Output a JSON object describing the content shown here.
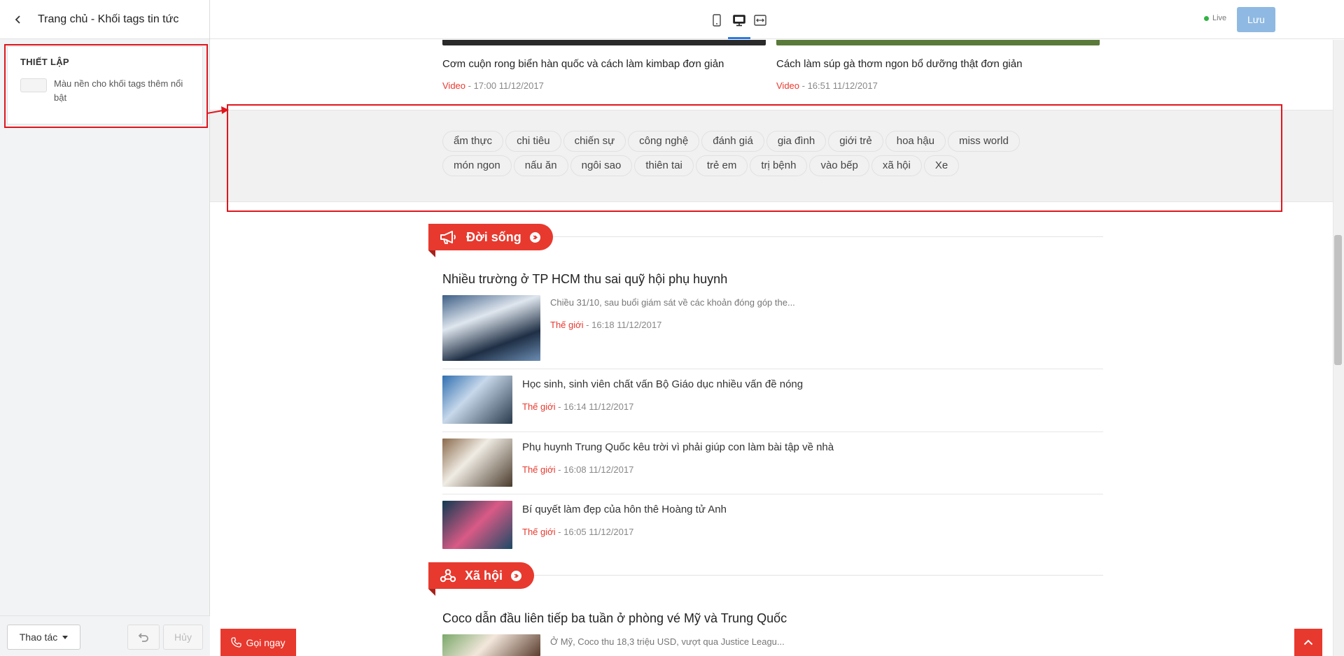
{
  "editor": {
    "title": "Trang chủ - Khối tags tin tức",
    "settings_title": "THIẾT LẬP",
    "bg_option_label": "Màu nền cho khối tags thêm nổi bật",
    "action_label": "Thao tác",
    "cancel_label": "Hủy",
    "live_label": "Live",
    "save_label": "Lưu"
  },
  "top_news": [
    {
      "title": "Cơm cuộn rong biển hàn quốc và cách làm kimbap đơn giản",
      "category": "Video",
      "time": "17:00 11/12/2017"
    },
    {
      "title": "Cách làm súp gà thơm ngon bổ dưỡng thật đơn giản",
      "category": "Video",
      "time": "16:51 11/12/2017"
    }
  ],
  "tags": [
    "ẩm thực",
    "chi tiêu",
    "chiến sự",
    "công nghệ",
    "đánh giá",
    "gia đình",
    "giới trẻ",
    "hoa hậu",
    "miss world",
    "món ngon",
    "nấu ăn",
    "ngôi sao",
    "thiên tai",
    "trẻ em",
    "trị bệnh",
    "vào bếp",
    "xã hội",
    "Xe"
  ],
  "sections": [
    {
      "name": "Đời sống",
      "lead": {
        "title": "Nhiều trường ở TP HCM thu sai quỹ hội phụ huynh",
        "desc": "Chiều 31/10, sau buổi giám sát về các khoản đóng góp the...",
        "category": "Thế giới",
        "time": "16:18 11/12/2017"
      },
      "items": [
        {
          "title": "Học sinh, sinh viên chất vấn Bộ Giáo dục nhiều vấn đề nóng",
          "category": "Thế giới",
          "time": "16:14 11/12/2017"
        },
        {
          "title": "Phụ huynh Trung Quốc kêu trời vì phải giúp con làm bài tập về nhà",
          "category": "Thế giới",
          "time": "16:08 11/12/2017"
        },
        {
          "title": "Bí quyết làm đẹp của hôn thê Hoàng tử Anh",
          "category": "Thế giới",
          "time": "16:05 11/12/2017"
        }
      ]
    },
    {
      "name": "Xã hội",
      "lead": {
        "title": "Coco dẫn đầu liên tiếp ba tuần ở phòng vé Mỹ và Trung Quốc",
        "desc": "Ở Mỹ, Coco thu 18,3 triệu USD, vượt qua Justice Leagu..."
      }
    }
  ],
  "call_label": "Gọi ngay",
  "colors": {
    "accent": "#e8392e",
    "highlight": "#e0161d",
    "save": "#8fb9e2",
    "live": "#32b343"
  },
  "icons": [
    "chevron-left-icon",
    "mobile-icon",
    "desktop-icon",
    "fit-width-icon",
    "undo-icon",
    "caret-down-icon",
    "megaphone-icon",
    "share-icon",
    "phone-icon",
    "chevron-up-icon"
  ]
}
